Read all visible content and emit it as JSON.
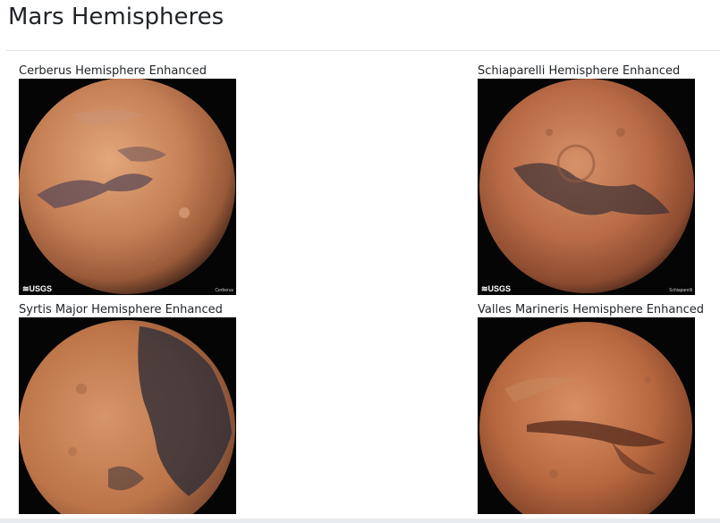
{
  "page": {
    "title": "Mars Hemispheres"
  },
  "hemispheres": [
    {
      "title": "Cerberus Hemisphere Enhanced",
      "logo_text": "≋USGS",
      "caption": "Cerberus"
    },
    {
      "title": "Schiaparelli Hemisphere Enhanced",
      "logo_text": "≋USGS",
      "caption": "Schiaparelli"
    },
    {
      "title": "Syrtis Major Hemisphere Enhanced"
    },
    {
      "title": "Valles Marineris Hemisphere Enhanced"
    }
  ],
  "colors": {
    "planet_light": "#d89a6e",
    "planet_mid": "#b8704a",
    "planet_dark": "#5a3222",
    "dark_region": "#2e2a30",
    "background": "#050505"
  }
}
